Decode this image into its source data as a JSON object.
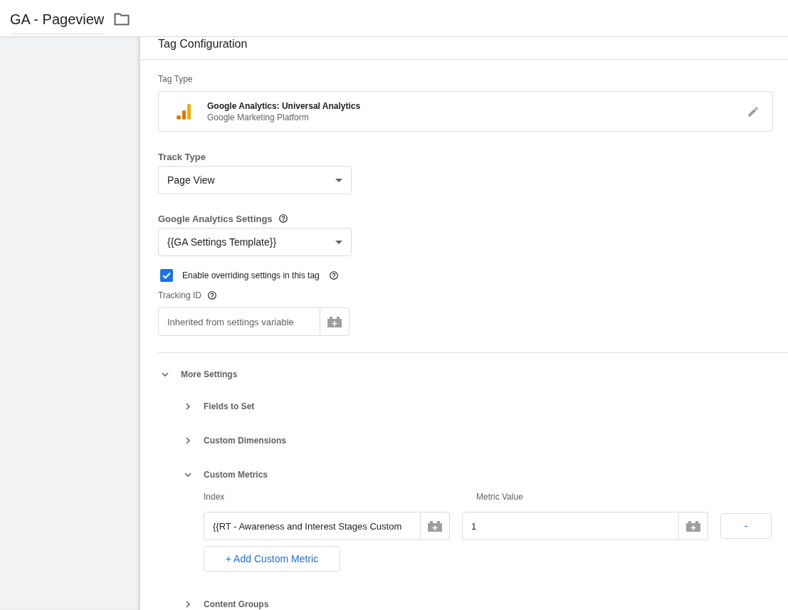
{
  "header": {
    "title": "GA - Pageview"
  },
  "panel": {
    "title": "Tag Configuration"
  },
  "tag_type": {
    "label": "Tag Type",
    "name": "Google Analytics: Universal Analytics",
    "vendor": "Google Marketing Platform"
  },
  "track_type": {
    "label": "Track Type",
    "value": "Page View"
  },
  "ga_settings": {
    "label": "Google Analytics Settings",
    "value": "{{GA Settings Template}}"
  },
  "override": {
    "label": "Enable overriding settings in this tag",
    "checked": true
  },
  "tracking_id": {
    "label": "Tracking ID",
    "placeholder": "Inherited from settings variable"
  },
  "more_settings": {
    "label": "More Settings",
    "expanded": true,
    "children": [
      {
        "label": "Fields to Set",
        "expanded": false
      },
      {
        "label": "Custom Dimensions",
        "expanded": false
      },
      {
        "label": "Custom Metrics",
        "expanded": true,
        "columns": [
          "Index",
          "Metric Value"
        ],
        "rows": [
          {
            "index": "{{RT - Awareness and Interest Stages Custom",
            "value": "1",
            "remove": "-"
          }
        ],
        "add_button": "+ Add Custom Metric"
      },
      {
        "label": "Content Groups",
        "expanded": false
      }
    ]
  }
}
